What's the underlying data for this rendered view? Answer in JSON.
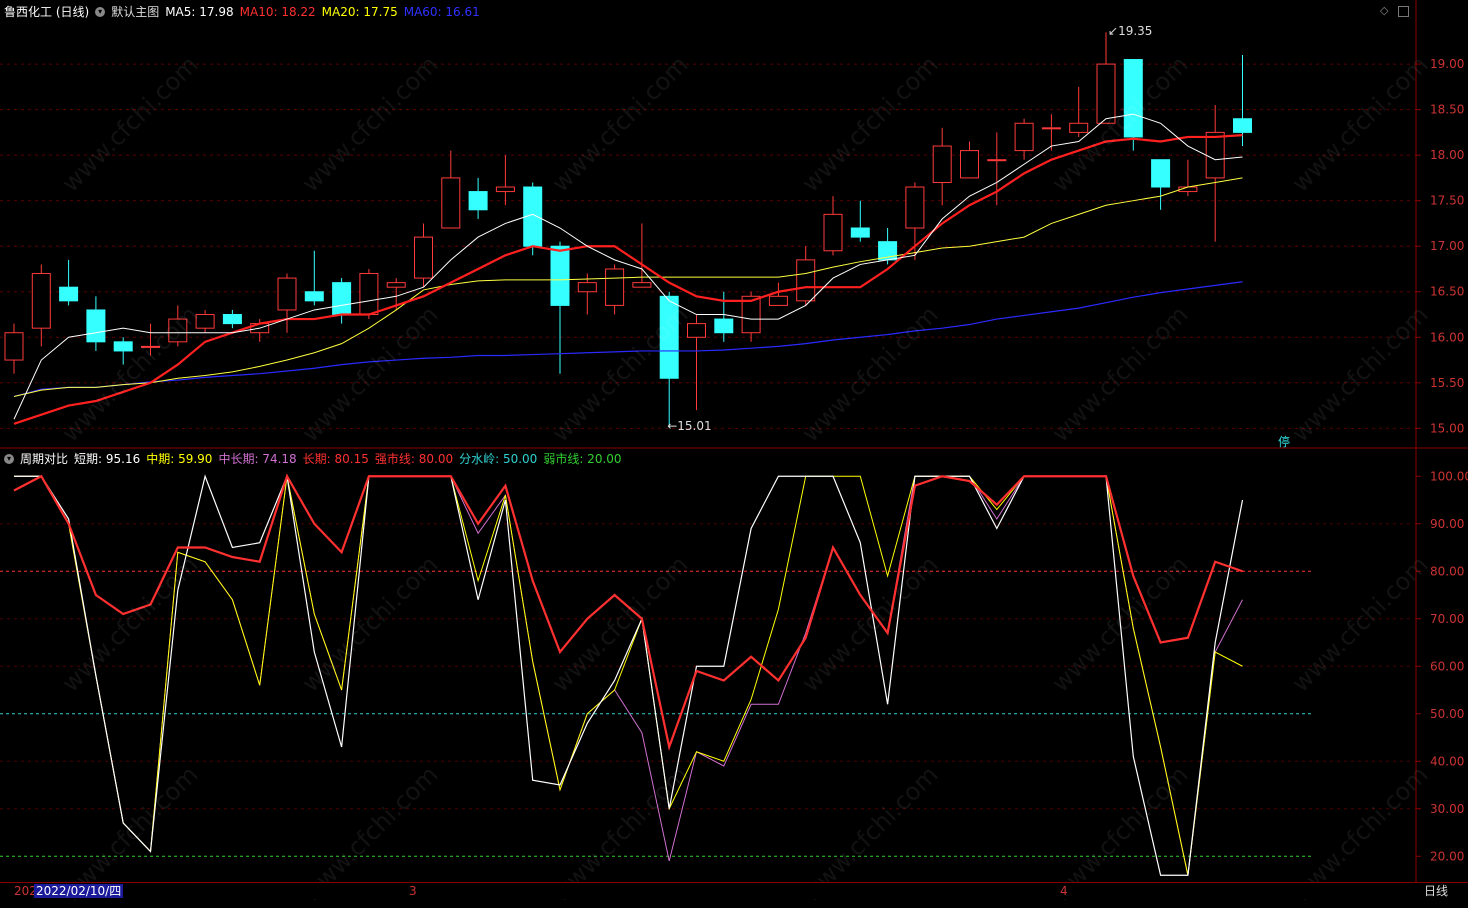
{
  "main_header": {
    "title": "鲁西化工 (日线)",
    "template": "默认主图",
    "ma": [
      {
        "label": "MA5: 17.98",
        "color": "#ffffff"
      },
      {
        "label": "MA10: 18.22",
        "color": "#ff3030"
      },
      {
        "label": "MA20: 17.75",
        "color": "#ffff00"
      },
      {
        "label": "MA60: 16.61",
        "color": "#3030ff"
      }
    ]
  },
  "sub_header": {
    "title": "周期对比",
    "items": [
      {
        "label": "短期: 95.16",
        "color": "#ffffff"
      },
      {
        "label": "中期: 59.90",
        "color": "#ffff00"
      },
      {
        "label": "中长期: 74.18",
        "color": "#d070d0"
      },
      {
        "label": "长期: 80.15",
        "color": "#ff3030"
      },
      {
        "label": "强市线: 80.00",
        "color": "#ff3030"
      },
      {
        "label": "分水岭: 50.00",
        "color": "#30d0d0"
      },
      {
        "label": "弱市线: 20.00",
        "color": "#30d030"
      }
    ]
  },
  "annotations": {
    "high": "19.35",
    "low": "15.01",
    "stop_badge": "停"
  },
  "bottom": {
    "date_prefix": "202",
    "date": "2022/02/10/四",
    "month_3": "3",
    "month_4": "4",
    "period": "日线"
  },
  "watermark": "www.cfchi.com",
  "chart_data": [
    {
      "type": "candlestick",
      "title": "鲁西化工 (日线)",
      "ylim": [
        14.85,
        19.55
      ],
      "yticks": [
        "15.00",
        "15.50",
        "16.00",
        "16.50",
        "17.00",
        "17.50",
        "18.00",
        "18.50",
        "19.00"
      ],
      "candles": [
        [
          15.75,
          16.05,
          16.15,
          15.6
        ],
        [
          16.1,
          16.7,
          16.8,
          15.9
        ],
        [
          16.55,
          16.4,
          16.85,
          16.35
        ],
        [
          16.3,
          15.95,
          16.45,
          15.85
        ],
        [
          15.95,
          15.85,
          16.0,
          15.7
        ],
        [
          15.9,
          15.9,
          16.15,
          15.8
        ],
        [
          15.95,
          16.2,
          16.35,
          15.9
        ],
        [
          16.1,
          16.25,
          16.3,
          16.05
        ],
        [
          16.25,
          16.15,
          16.3,
          16.1
        ],
        [
          16.05,
          16.15,
          16.2,
          15.95
        ],
        [
          16.3,
          16.65,
          16.7,
          16.05
        ],
        [
          16.5,
          16.4,
          16.95,
          16.35
        ],
        [
          16.6,
          16.25,
          16.65,
          16.15
        ],
        [
          16.25,
          16.7,
          16.75,
          16.2
        ],
        [
          16.55,
          16.6,
          16.65,
          16.3
        ],
        [
          16.65,
          17.1,
          17.25,
          16.55
        ],
        [
          17.2,
          17.75,
          18.05,
          17.2
        ],
        [
          17.6,
          17.4,
          17.75,
          17.3
        ],
        [
          17.6,
          17.65,
          18.0,
          17.45
        ],
        [
          17.65,
          17.0,
          17.7,
          16.9
        ],
        [
          17.0,
          16.35,
          17.05,
          15.6
        ],
        [
          16.5,
          16.6,
          16.7,
          16.25
        ],
        [
          16.35,
          16.75,
          16.8,
          16.25
        ],
        [
          16.55,
          16.6,
          17.25,
          16.55
        ],
        [
          16.45,
          15.55,
          16.5,
          15.01
        ],
        [
          16.0,
          16.15,
          16.25,
          15.2
        ],
        [
          16.2,
          16.05,
          16.5,
          15.95
        ],
        [
          16.05,
          16.45,
          16.5,
          15.95
        ],
        [
          16.35,
          16.45,
          16.6,
          16.35
        ],
        [
          16.4,
          16.85,
          17.0,
          16.35
        ],
        [
          16.95,
          17.35,
          17.55,
          16.9
        ],
        [
          17.2,
          17.1,
          17.5,
          17.05
        ],
        [
          17.05,
          16.85,
          17.2,
          16.8
        ],
        [
          17.2,
          17.65,
          17.7,
          16.85
        ],
        [
          17.7,
          18.1,
          18.3,
          17.45
        ],
        [
          17.75,
          18.05,
          18.15,
          17.75
        ],
        [
          17.95,
          17.95,
          18.25,
          17.45
        ],
        [
          18.05,
          18.35,
          18.4,
          17.95
        ],
        [
          18.3,
          18.3,
          18.45,
          18.05
        ],
        [
          18.25,
          18.35,
          18.75,
          18.2
        ],
        [
          18.35,
          19.0,
          19.35,
          18.35
        ],
        [
          19.05,
          18.2,
          19.05,
          18.05
        ],
        [
          17.95,
          17.65,
          17.95,
          17.4
        ],
        [
          17.6,
          17.65,
          17.95,
          17.55
        ],
        [
          17.75,
          18.25,
          18.55,
          17.05
        ],
        [
          18.4,
          18.25,
          19.1,
          18.1
        ]
      ],
      "ma5": [
        15.1,
        15.75,
        16.0,
        16.05,
        16.1,
        16.05,
        16.05,
        16.05,
        16.05,
        16.1,
        16.2,
        16.3,
        16.35,
        16.4,
        16.45,
        16.55,
        16.85,
        17.1,
        17.25,
        17.35,
        17.2,
        17.0,
        16.85,
        16.75,
        16.4,
        16.25,
        16.25,
        16.2,
        16.2,
        16.35,
        16.65,
        16.8,
        16.85,
        16.9,
        17.3,
        17.55,
        17.7,
        17.9,
        18.1,
        18.15,
        18.4,
        18.45,
        18.35,
        18.1,
        17.95,
        17.98
      ],
      "ma10": [
        15.05,
        15.15,
        15.25,
        15.3,
        15.4,
        15.5,
        15.7,
        15.95,
        16.05,
        16.15,
        16.2,
        16.2,
        16.25,
        16.25,
        16.35,
        16.45,
        16.6,
        16.75,
        16.9,
        17.0,
        16.95,
        17.0,
        17.0,
        16.8,
        16.6,
        16.45,
        16.4,
        16.4,
        16.5,
        16.55,
        16.55,
        16.55,
        16.75,
        17.0,
        17.25,
        17.45,
        17.6,
        17.8,
        17.95,
        18.05,
        18.15,
        18.18,
        18.15,
        18.2,
        18.2,
        18.22
      ],
      "ma20": [
        15.35,
        15.42,
        15.45,
        15.45,
        15.48,
        15.5,
        15.55,
        15.58,
        15.62,
        15.68,
        15.75,
        15.83,
        15.93,
        16.1,
        16.3,
        16.52,
        16.58,
        16.62,
        16.63,
        16.63,
        16.63,
        16.64,
        16.65,
        16.66,
        16.66,
        16.66,
        16.66,
        16.66,
        16.66,
        16.7,
        16.77,
        16.83,
        16.88,
        16.93,
        16.98,
        17.0,
        17.05,
        17.1,
        17.25,
        17.35,
        17.45,
        17.5,
        17.55,
        17.65,
        17.7,
        17.75
      ],
      "ma60": [
        15.35,
        15.43,
        15.45,
        15.45,
        15.48,
        15.51,
        15.53,
        15.56,
        15.58,
        15.6,
        15.63,
        15.66,
        15.7,
        15.73,
        15.75,
        15.77,
        15.78,
        15.8,
        15.8,
        15.81,
        15.82,
        15.83,
        15.84,
        15.85,
        15.85,
        15.85,
        15.86,
        15.88,
        15.9,
        15.93,
        15.97,
        16.0,
        16.03,
        16.07,
        16.1,
        16.14,
        16.2,
        16.24,
        16.28,
        16.32,
        16.38,
        16.44,
        16.49,
        16.53,
        16.57,
        16.61
      ]
    },
    {
      "type": "line",
      "title": "周期对比",
      "ylim": [
        15,
        103
      ],
      "yticks": [
        "20.00",
        "30.00",
        "40.00",
        "50.00",
        "60.00",
        "70.00",
        "80.00",
        "90.00",
        "100.00"
      ],
      "reference_lines": [
        {
          "name": "强市线",
          "value": 80,
          "color": "#ff3030"
        },
        {
          "name": "分水岭",
          "value": 50,
          "color": "#30d0d0"
        },
        {
          "name": "弱市线",
          "value": 20,
          "color": "#30d030"
        }
      ],
      "series": [
        {
          "name": "短期",
          "color": "#ffffff",
          "values": [
            100,
            100,
            91,
            58,
            27,
            21,
            76,
            100,
            85,
            86,
            100,
            63,
            43,
            100,
            100,
            100,
            100,
            74,
            95,
            36,
            35,
            48,
            57,
            70,
            30,
            60,
            60,
            89,
            100,
            100,
            100,
            86,
            52,
            100,
            100,
            100,
            89,
            100,
            100,
            100,
            100,
            41,
            16,
            16,
            65,
            95
          ]
        },
        {
          "name": "中期",
          "color": "#ffff00",
          "values": [
            100,
            100,
            90,
            58,
            27,
            21,
            84,
            82,
            74,
            56,
            100,
            71,
            55,
            100,
            100,
            100,
            100,
            78,
            96,
            61,
            34,
            50,
            55,
            70,
            30,
            42,
            40,
            53,
            72,
            100,
            100,
            100,
            79,
            100,
            100,
            100,
            93,
            100,
            100,
            100,
            100,
            68,
            43,
            16,
            63,
            60
          ]
        },
        {
          "name": "中长期",
          "color": "#d070d0",
          "values": [
            100,
            100,
            90,
            58,
            27,
            21,
            84,
            82,
            74,
            56,
            100,
            71,
            55,
            100,
            100,
            100,
            100,
            88,
            96,
            61,
            34,
            50,
            55,
            46,
            19,
            42,
            39,
            52,
            52,
            67,
            85,
            75,
            67,
            100,
            100,
            100,
            91,
            100,
            100,
            100,
            100,
            68,
            43,
            16,
            63,
            74
          ]
        },
        {
          "name": "长期",
          "color": "#ff3030",
          "values": [
            97,
            100,
            90,
            75,
            71,
            73,
            85,
            85,
            83,
            82,
            100,
            90,
            84,
            100,
            100,
            100,
            100,
            90,
            98,
            78,
            63,
            70,
            75,
            70,
            43,
            59,
            57,
            62,
            57,
            66,
            85,
            75,
            67,
            98,
            100,
            99,
            94,
            100,
            100,
            100,
            100,
            79,
            65,
            66,
            82,
            80
          ]
        }
      ]
    }
  ]
}
